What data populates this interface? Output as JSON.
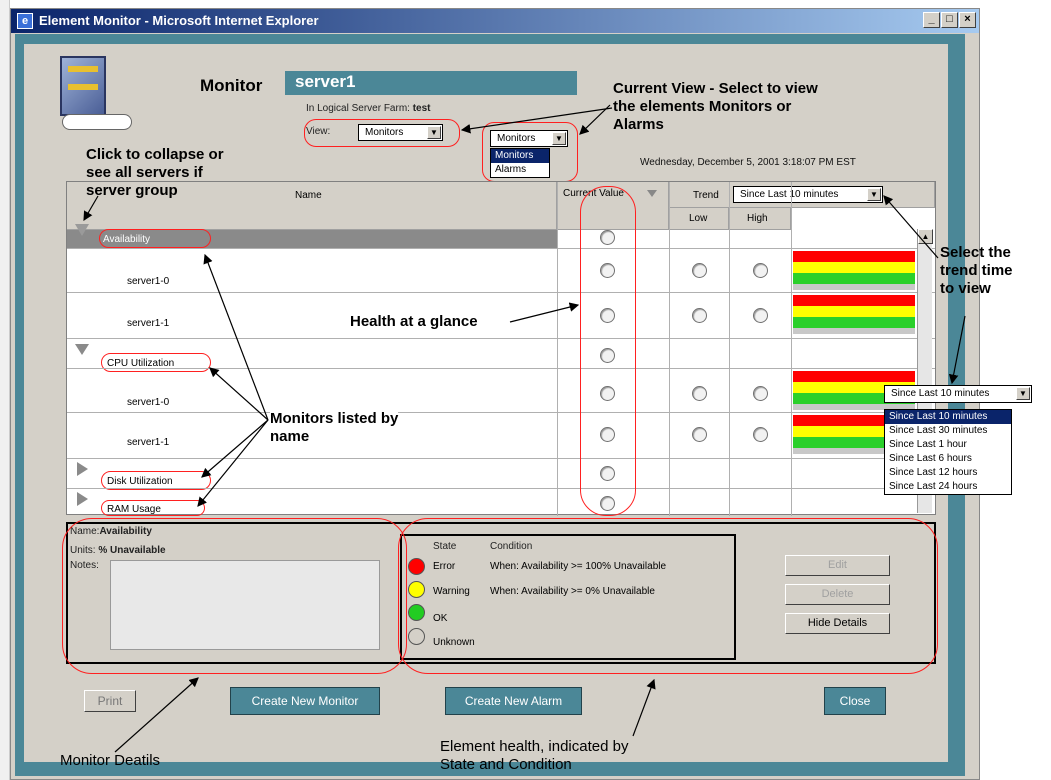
{
  "window": {
    "title": "Element Monitor - Microsoft Internet Explorer",
    "ie_icon": "e",
    "btn_min": "_",
    "btn_max": "□",
    "btn_close": "×"
  },
  "header": {
    "monitor_label": "Monitor",
    "server_tab": "server1",
    "farm_label": "In Logical Server Farm:",
    "farm_value": "test",
    "view_label": "View:",
    "view_value": "Monitors",
    "view_combo2": "Monitors",
    "view_options": [
      "Monitors",
      "Alarms"
    ],
    "date": "Wednesday, December 5, 2001 3:18:07 PM EST"
  },
  "grid": {
    "col_name": "Name",
    "col_current": "Current Value",
    "col_trend": "Trend",
    "trend_value": "Since Last 10 minutes",
    "col_low": "Low",
    "col_high": "High",
    "rows": [
      {
        "label": "Availability"
      },
      {
        "label": "server1-0"
      },
      {
        "label": "server1-1"
      },
      {
        "label": "CPU Utilization"
      },
      {
        "label": "server1-0"
      },
      {
        "label": "server1-1"
      },
      {
        "label": "Disk Utilization"
      },
      {
        "label": "RAM Usage"
      }
    ]
  },
  "trend_popup": {
    "value": "Since Last 10 minutes",
    "options": [
      "Since Last 10 minutes",
      "Since Last 30 minutes",
      "Since Last 1 hour",
      "Since Last 6 hours",
      "Since Last 12 hours",
      "Since Last 24 hours"
    ]
  },
  "details": {
    "name_label": "Name:",
    "name_value": "Availability",
    "units_label": "Units:",
    "units_value": "% Unavailable",
    "notes_label": "Notes:",
    "state_hdr": "State",
    "condition_hdr": "Condition",
    "states": [
      {
        "state": "Error",
        "condition": "When: Availability >= 100% Unavailable",
        "color": "#ff0000"
      },
      {
        "state": "Warning",
        "condition": "When: Availability >= 0% Unavailable",
        "color": "#ffff00"
      },
      {
        "state": "OK",
        "condition": "",
        "color": "#22cc22"
      },
      {
        "state": "Unknown",
        "condition": "",
        "color": "#d4d0c8"
      }
    ],
    "edit": "Edit",
    "delete": "Delete",
    "hide": "Hide Details"
  },
  "buttons": {
    "print": "Print",
    "create_monitor": "Create New Monitor",
    "create_alarm": "Create New Alarm",
    "close": "Close"
  },
  "annotations": {
    "current_view": "Current View - Select to view the elements Monitors or Alarms",
    "current_view_l1": "Current View - Select to view",
    "current_view_l2": "the elements Monitors or",
    "current_view_l3": "Alarms",
    "collapse_l1": "Click to collapse or",
    "collapse_l2": "see all servers if",
    "collapse_l3": "server group",
    "trend_l1": "Select the",
    "trend_l2": "trend time",
    "trend_l3": "to view",
    "health": "Health at a glance",
    "monitors_l1": "Monitors listed by",
    "monitors_l2": "name",
    "monitor_details": "Monitor Deatils",
    "element_health_l1": "Element health, indicated by",
    "element_health_l2": "State and Condition"
  }
}
